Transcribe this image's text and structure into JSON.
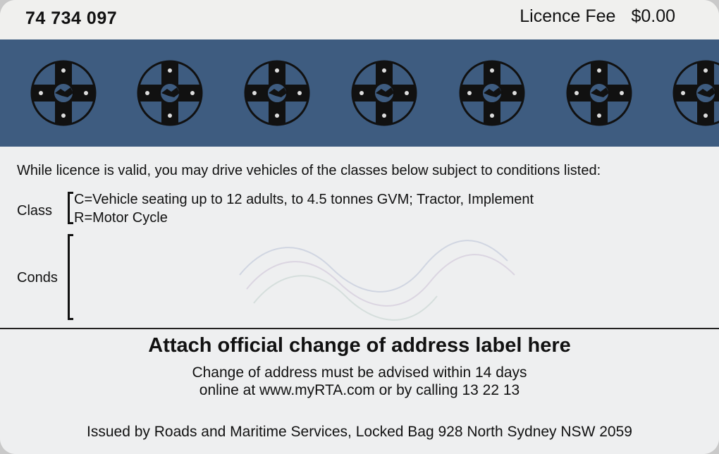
{
  "header": {
    "licence_number": "74 734 097",
    "fee_label": "Licence Fee",
    "fee_value": "$0.00"
  },
  "band": {
    "color": "#3e5c80",
    "emblem_icon": "nsw-crest-icon",
    "emblem_count": 7
  },
  "conditions": {
    "intro": "While licence is valid, you may drive vehicles of the classes below subject to conditions listed:",
    "class_label": "Class",
    "classes": [
      "C=Vehicle seating up to 12 adults, to 4.5 tonnes GVM; Tractor, Implement",
      "R=Motor Cycle"
    ],
    "conds_label": "Conds"
  },
  "address": {
    "title": "Attach official change of address label here",
    "line1": "Change of address must be advised within 14 days",
    "line2": "online at www.myRTA.com or by calling 13 22 13"
  },
  "footer": {
    "issued_by": "Issued by Roads and Maritime Services, Locked Bag 928 North Sydney NSW 2059"
  }
}
